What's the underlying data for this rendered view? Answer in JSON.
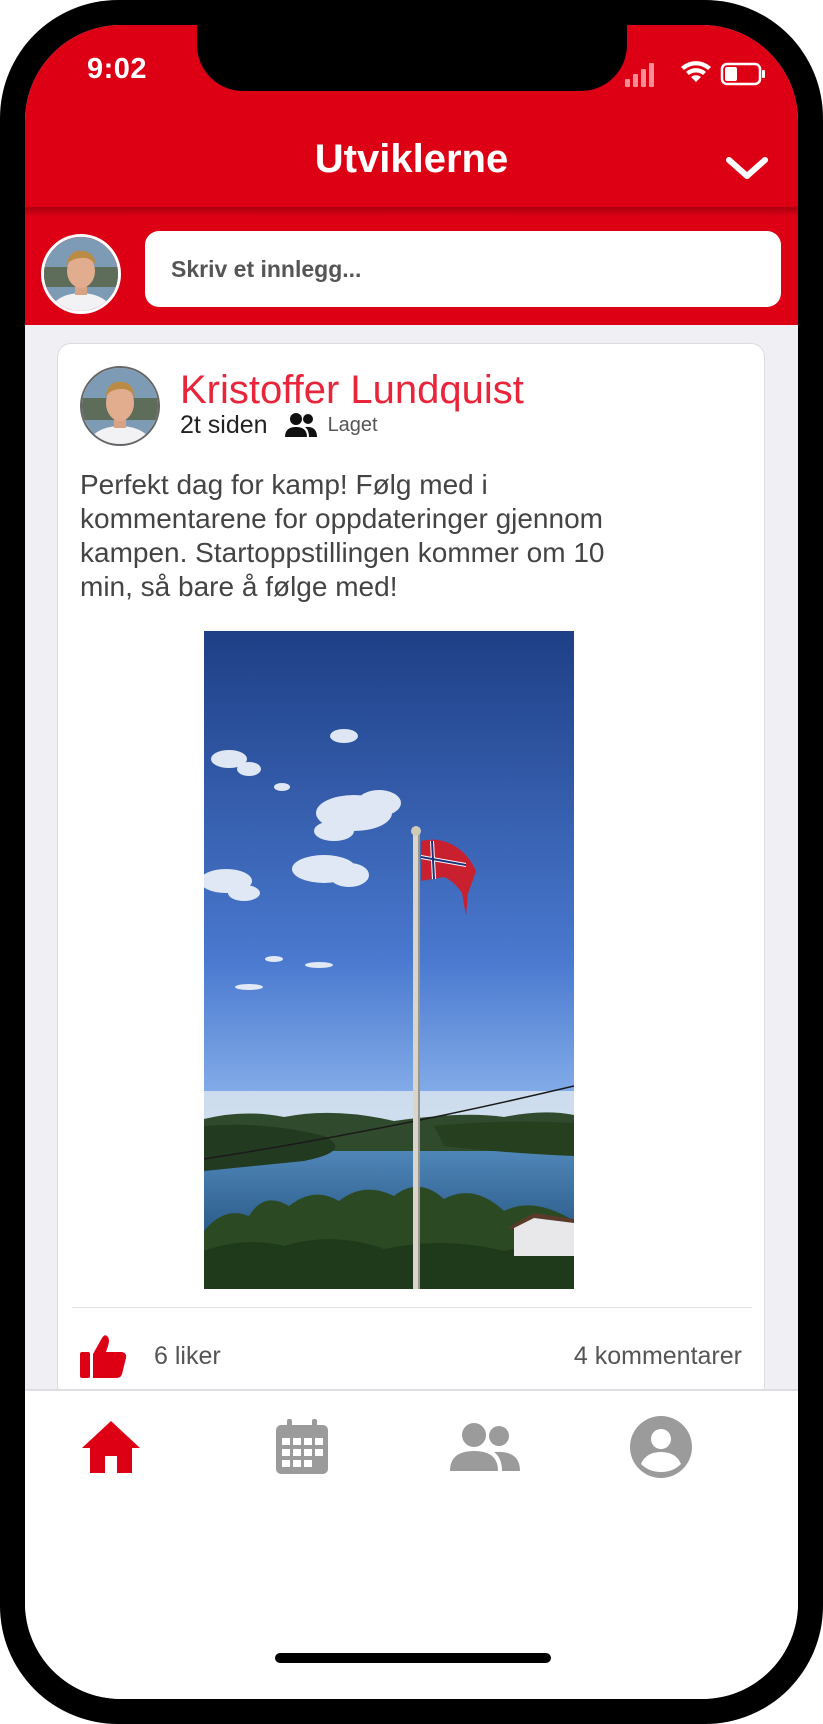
{
  "status_bar": {
    "time": "9:02"
  },
  "header": {
    "title": "Utviklerne"
  },
  "composer": {
    "placeholder": "Skriv et innlegg..."
  },
  "post": {
    "author": "Kristoffer Lundquist",
    "time_ago": "2t siden",
    "audience": "Laget",
    "text": "Perfekt dag for kamp! Følg med i kommentarene for oppdateringer gjennom kampen. Startoppstillingen kommer om 10 min, så bare å følge med!",
    "likes": "6 liker",
    "comments": "4 kommentarer"
  },
  "tabs": [
    {
      "icon": "home-icon",
      "active": true
    },
    {
      "icon": "calendar-icon",
      "active": false
    },
    {
      "icon": "team-icon",
      "active": false
    },
    {
      "icon": "profile-icon",
      "active": false
    }
  ],
  "colors": {
    "brand": "#dd0014",
    "author_name": "#e8253b",
    "inactive_icon": "#9b9b9b",
    "background": "#efeff4"
  }
}
